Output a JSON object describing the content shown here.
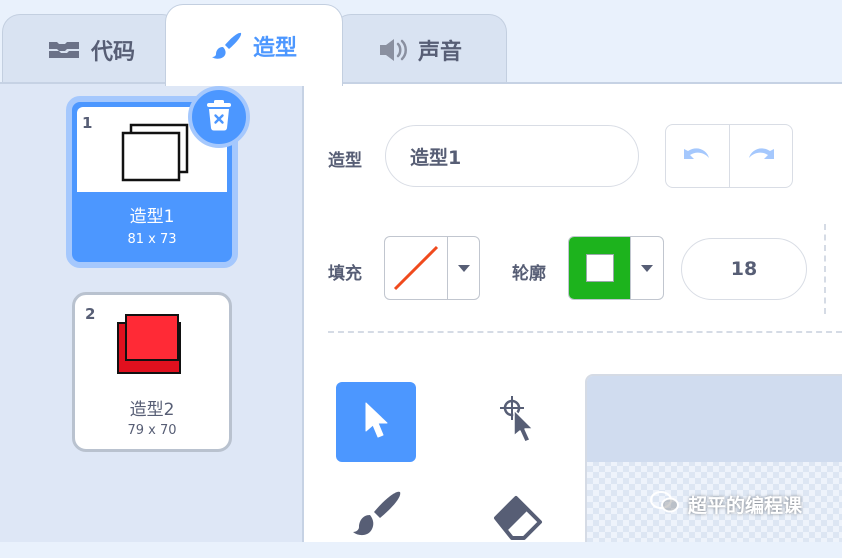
{
  "tabs": [
    {
      "label": "代码",
      "icon": "code-blocks-icon"
    },
    {
      "label": "造型",
      "icon": "paintbrush-icon",
      "active": true
    },
    {
      "label": "声音",
      "icon": "speaker-icon"
    }
  ],
  "costumes": [
    {
      "number": "1",
      "name": "造型1",
      "size": "81 x 73",
      "selected": true
    },
    {
      "number": "2",
      "name": "造型2",
      "size": "79 x 70",
      "selected": false
    }
  ],
  "editor": {
    "costume_label": "造型",
    "costume_name": "造型1",
    "fill_label": "填充",
    "outline_label": "轮廓",
    "outline_width": "18"
  },
  "colors": {
    "accent": "#4c97ff",
    "outline_color": "#1db31d",
    "fill_color": "none",
    "costume2_color": "#ff2a36"
  },
  "tools": [
    {
      "name": "select-tool",
      "icon": "arrow-pointer-icon",
      "active": true
    },
    {
      "name": "reshape-tool",
      "icon": "reshape-pointer-icon",
      "active": false
    },
    {
      "name": "brush-tool",
      "icon": "brush-icon",
      "active": false
    },
    {
      "name": "eraser-tool",
      "icon": "eraser-icon",
      "active": false
    }
  ],
  "watermark": "超平的编程课"
}
